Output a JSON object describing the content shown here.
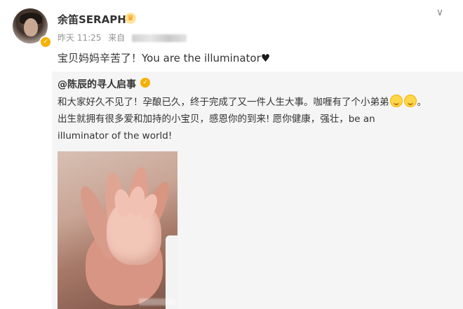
{
  "post": {
    "username": "余笛SERAPH",
    "time": "昨天 11:25",
    "source_prefix": "来自",
    "text": "宝贝妈妈辛苦了！You are the illuminator",
    "heart_icon": "♥"
  },
  "repost": {
    "username": "@陈辰的寻人启事",
    "body_line1": "和大家好久不见了！孕酿已久，终于完成了又一件人生大事。咖喱有了个小弟弟",
    "body_line1_end": "。",
    "body_line2": "出生就拥有很多爱和加持的小宝贝，感恩你的到来! 愿你健康，强壮，be an",
    "body_line3": "illuminator of the world!"
  },
  "icons": {
    "verified": "✓",
    "crown": "♛",
    "chevron": "∨"
  }
}
